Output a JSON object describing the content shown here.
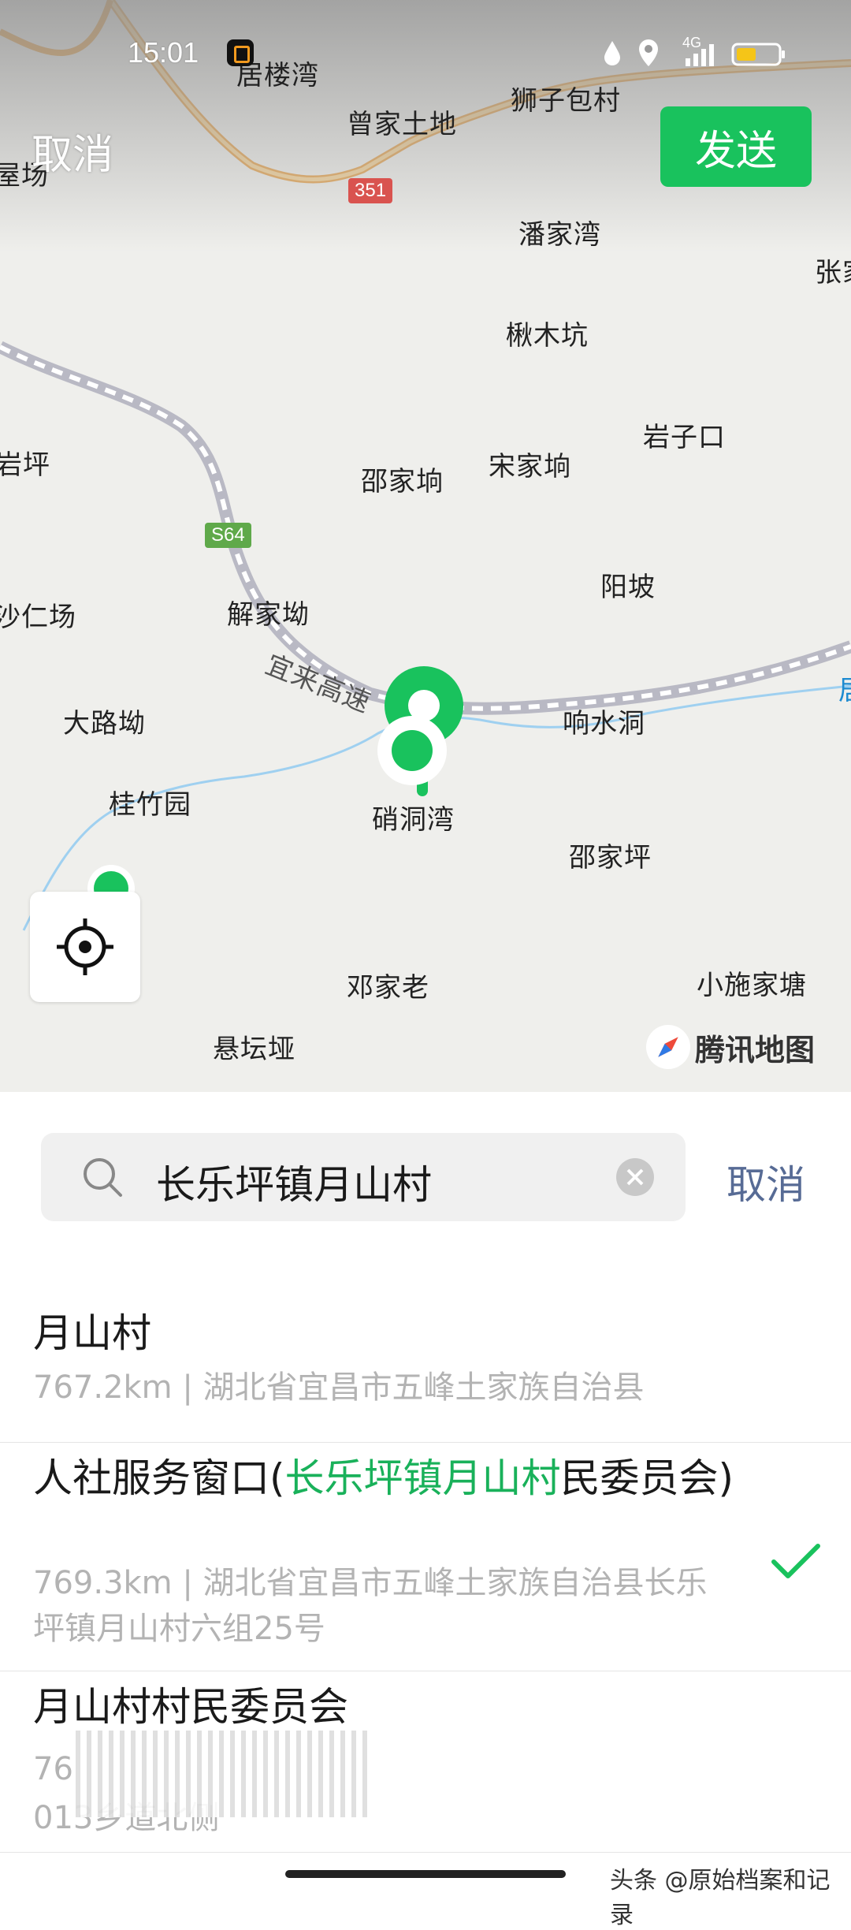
{
  "status_bar": {
    "time": "15:01",
    "network": "4G"
  },
  "header": {
    "cancel_label": "取消",
    "send_label": "发送"
  },
  "map": {
    "provider_logo": "腾讯地图",
    "highways": [
      {
        "code": "351",
        "color": "#d9534f"
      },
      {
        "code": "S64",
        "color": "#5fa94a"
      }
    ],
    "expressway_name": "宜来高速",
    "places": [
      "居楼湾",
      "曾家土地",
      "狮子包村",
      "屋场",
      "潘家湾",
      "张家",
      "楸木坑",
      "岩子口",
      "岩坪",
      "邵家垧",
      "宋家垧",
      "阳坡",
      "沙仁场",
      "解家坳",
      "大路坳",
      "响水洞",
      "桂竹园",
      "硝洞湾",
      "邵家坪",
      "邓家老",
      "小施家塘",
      "悬坛垭",
      "居"
    ],
    "pin_color": "#19c25d",
    "locate_icon": "crosshair-icon"
  },
  "search": {
    "query": "长乐坪镇月山村",
    "cancel_label": "取消"
  },
  "results": [
    {
      "title": "月山村",
      "distance": "767.2km",
      "address": "湖北省宜昌市五峰土家族自治县",
      "selected": false
    },
    {
      "title_prefix": "人社服务窗口(",
      "title_highlight": "长乐坪镇月山村",
      "title_suffix": "民委员会)",
      "distance": "769.3km",
      "address": "湖北省宜昌市五峰土家族自治县长乐坪镇月山村六组25号",
      "selected": true
    },
    {
      "title": "月山村村民委员会",
      "distance": "76",
      "address": "013乡道北侧",
      "selected": false
    }
  ],
  "watermark": "头条 @原始档案和记录",
  "colors": {
    "accent": "#19c25d",
    "link": "#576b95"
  }
}
